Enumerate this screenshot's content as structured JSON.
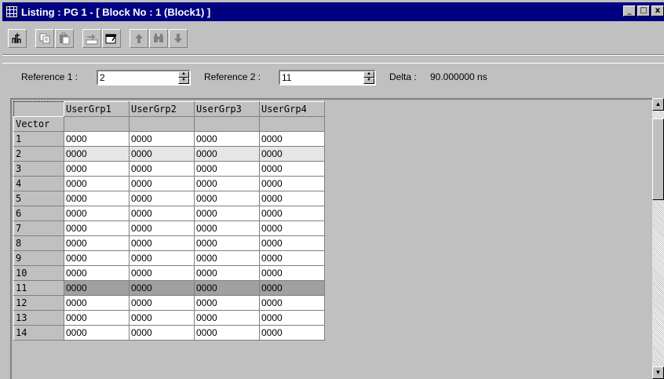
{
  "window": {
    "title": "Listing : PG 1 - [ Block No : 1 (Block1) ]",
    "app_icon": "grid-icon",
    "controls": {
      "minimize": "_",
      "maximize": "□",
      "close": "x"
    }
  },
  "toolbar": {
    "buttons": [
      {
        "name": "insert-signal-icon"
      },
      {
        "name": "copy-icon"
      },
      {
        "name": "paste-icon"
      },
      {
        "name": "goto-icon"
      },
      {
        "name": "properties-icon"
      },
      {
        "name": "arrow-up-icon"
      },
      {
        "name": "find-icon"
      },
      {
        "name": "arrow-down-icon"
      }
    ]
  },
  "reference": {
    "ref1_label": "Reference 1 :",
    "ref1_value": "2",
    "ref2_label": "Reference 2 :",
    "ref2_value": "11",
    "delta_label": "Delta :",
    "delta_value": "90.000000 ns"
  },
  "grid": {
    "columns": [
      "UserGrp1",
      "UserGrp2",
      "UserGrp3",
      "UserGrp4"
    ],
    "vector_label": "Vector",
    "rows": [
      {
        "label": "1",
        "values": [
          "0000",
          "0000",
          "0000",
          "0000"
        ]
      },
      {
        "label": "2",
        "values": [
          "0000",
          "0000",
          "0000",
          "0000"
        ]
      },
      {
        "label": "3",
        "values": [
          "0000",
          "0000",
          "0000",
          "0000"
        ]
      },
      {
        "label": "4",
        "values": [
          "0000",
          "0000",
          "0000",
          "0000"
        ]
      },
      {
        "label": "5",
        "values": [
          "0000",
          "0000",
          "0000",
          "0000"
        ]
      },
      {
        "label": "6",
        "values": [
          "0000",
          "0000",
          "0000",
          "0000"
        ]
      },
      {
        "label": "7",
        "values": [
          "0000",
          "0000",
          "0000",
          "0000"
        ]
      },
      {
        "label": "8",
        "values": [
          "0000",
          "0000",
          "0000",
          "0000"
        ]
      },
      {
        "label": "9",
        "values": [
          "0000",
          "0000",
          "0000",
          "0000"
        ]
      },
      {
        "label": "10",
        "values": [
          "0000",
          "0000",
          "0000",
          "0000"
        ]
      },
      {
        "label": "11",
        "values": [
          "0000",
          "0000",
          "0000",
          "0000"
        ]
      },
      {
        "label": "12",
        "values": [
          "0000",
          "0000",
          "0000",
          "0000"
        ]
      },
      {
        "label": "13",
        "values": [
          "0000",
          "0000",
          "0000",
          "0000"
        ]
      },
      {
        "label": "14",
        "values": [
          "0000",
          "0000",
          "0000",
          "0000"
        ]
      }
    ],
    "ref1_row": "2",
    "ref2_row": "11"
  },
  "colors": {
    "titlebar": "#000080",
    "ref1_highlight": "#e6e6e6",
    "ref2_highlight": "#a0a0a0"
  }
}
